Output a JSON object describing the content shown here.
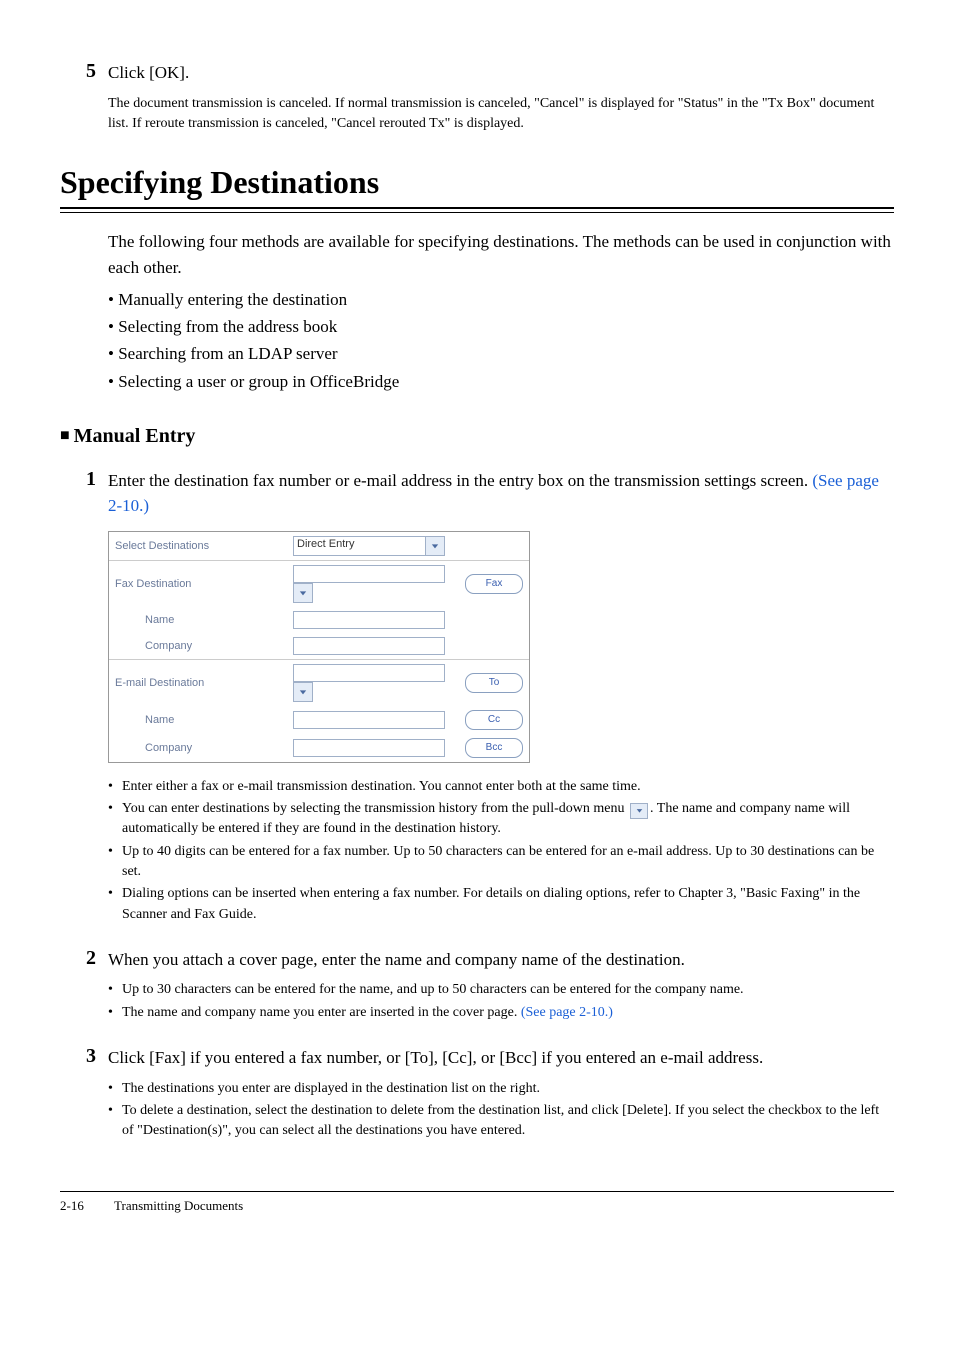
{
  "step5": {
    "num": "5",
    "text": "Click [OK].",
    "note": "The document transmission is canceled. If normal transmission is canceled, \"Cancel\" is displayed for \"Status\" in the \"Tx Box\" document list. If reroute transmission is canceled, \"Cancel rerouted Tx\" is displayed."
  },
  "section_title": "Specifying Destinations",
  "intro": "The following four methods are available for specifying destinations. The methods can be used in conjunction with each other.",
  "methods": [
    "Manually entering the destination",
    "Selecting from the address book",
    "Searching from an LDAP server",
    "Selecting a user or group in OfficeBridge"
  ],
  "sub_title": "Manual Entry",
  "step1": {
    "num": "1",
    "text_a": "Enter the destination fax number or e-mail address in the entry box on the transmission settings screen. ",
    "link": "(See page 2-10.)"
  },
  "ui": {
    "select_dest": "Select Destinations",
    "direct_entry": "Direct Entry",
    "fax_dest": "Fax Destination",
    "name": "Name",
    "company": "Company",
    "email_dest": "E-mail Destination",
    "btn_fax": "Fax",
    "btn_to": "To",
    "btn_cc": "Cc",
    "btn_bcc": "Bcc"
  },
  "step1_bullets": [
    "Enter either a fax or e-mail transmission destination. You cannot enter both at the same time.",
    "You can enter destinations by selecting the transmission history from the pull-down menu __DROP__. The name and company name will automatically be entered if they are found in the destination history.",
    "Up to 40 digits can be entered for a fax number. Up to 50 characters can be entered for an e-mail address. Up to 30 destinations can be set.",
    "Dialing options can be inserted when entering a fax number. For details on dialing options, refer to Chapter 3, \"Basic Faxing\" in the Scanner and Fax Guide."
  ],
  "step2": {
    "num": "2",
    "text": "When you attach a cover page, enter the name and company name of the destination.",
    "bullets": [
      {
        "t": "Up to 30 characters can be entered for the name, and up to 50 characters can be entered for the company name."
      },
      {
        "t": "The name and company name you enter are inserted in the cover page. ",
        "link": "(See page 2-10.)"
      }
    ]
  },
  "step3": {
    "num": "3",
    "text": "Click [Fax] if you entered a fax number, or [To], [Cc], or [Bcc] if you entered an e-mail address.",
    "bullets": [
      {
        "t": "The destinations you enter are displayed in the destination list on the right."
      },
      {
        "t": "To delete a destination, select the destination to delete from the destination list, and click [Delete]. If you select the checkbox to the left of \"Destination(s)\", you can select all the destinations you have entered."
      }
    ]
  },
  "footer": {
    "page": "2-16",
    "title": "Transmitting Documents"
  }
}
